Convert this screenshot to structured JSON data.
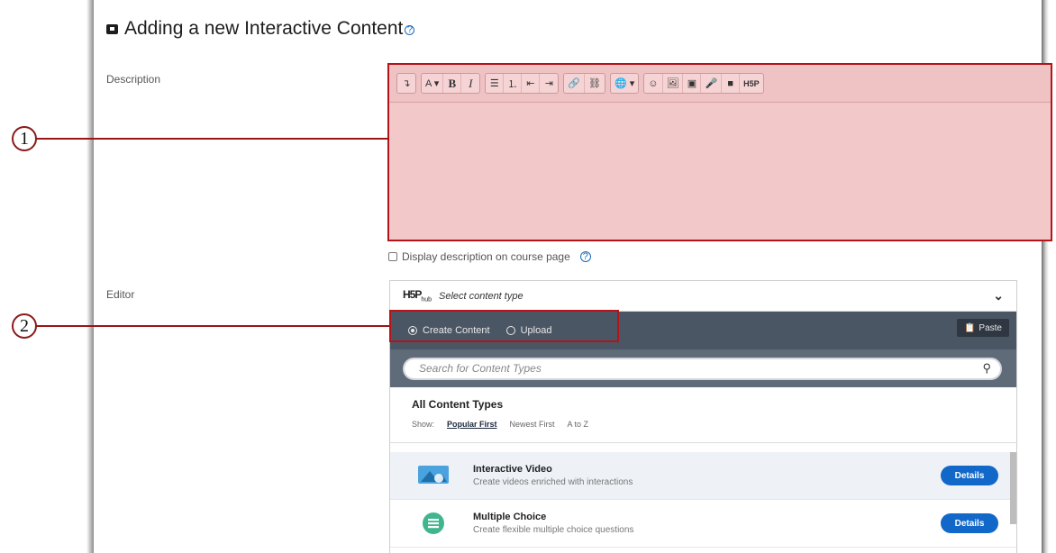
{
  "heading": {
    "title": "Adding a new Interactive Content",
    "help": "?"
  },
  "description_label": "Description",
  "toolbar": {
    "groups": [
      [
        "↴"
      ],
      [
        "A ▾",
        "B",
        "I"
      ],
      [
        "☰",
        "⒈",
        "⇤",
        "⇥"
      ],
      [
        "🔗",
        "⛓"
      ],
      [
        "🌐 ▾"
      ],
      [
        "☺",
        "🖼",
        "▣",
        "🎤",
        "■",
        "H5P"
      ]
    ]
  },
  "display_description": {
    "label": "Display description on course page",
    "help": "?"
  },
  "editor_label": "Editor",
  "hub": {
    "logo": "H5P",
    "logo_sub": "hub",
    "title": "Select content type",
    "tabs": [
      {
        "label": "Create Content",
        "selected": true
      },
      {
        "label": "Upload",
        "selected": false
      }
    ],
    "paste_label": "Paste",
    "search_placeholder": "Search for Content Types",
    "all_title": "All Content Types",
    "show_label": "Show:",
    "sort_options": [
      "Popular First",
      "Newest First",
      "A to Z"
    ],
    "items": [
      {
        "title": "Interactive Video",
        "desc": "Create videos enriched with interactions",
        "button": "Details",
        "icon": "interactive-video-icon"
      },
      {
        "title": "Multiple Choice",
        "desc": "Create flexible multiple choice questions",
        "button": "Details",
        "icon": "multiple-choice-icon"
      }
    ]
  },
  "callouts": [
    "1",
    "2"
  ],
  "colors": {
    "highlight": "#b3141a",
    "details_button": "#1168c9",
    "hub_dark": "#4b5664"
  }
}
